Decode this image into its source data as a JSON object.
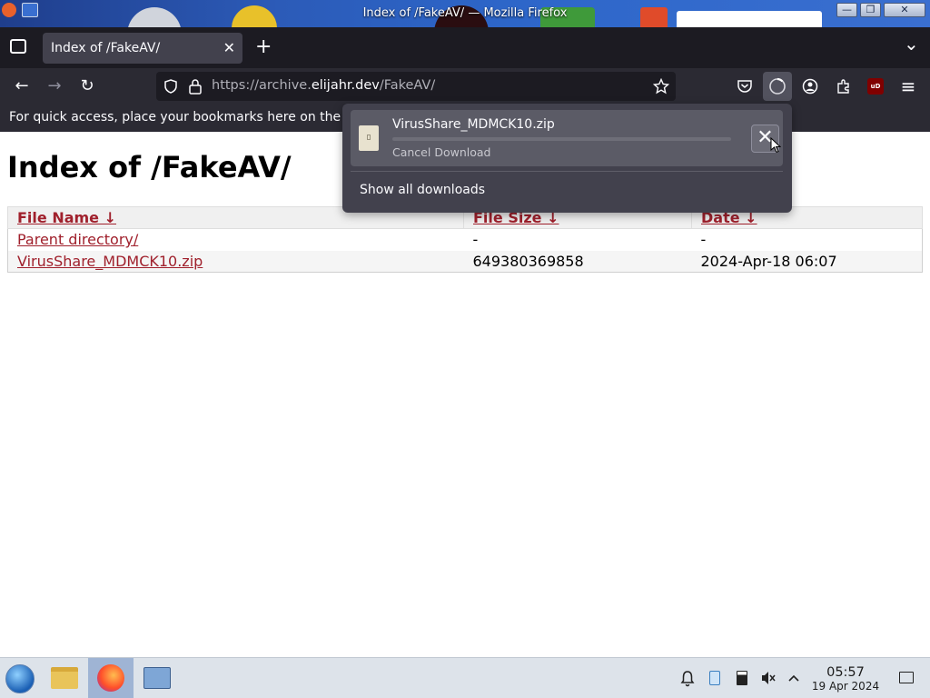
{
  "window": {
    "title": "Index of /FakeAV/ — Mozilla Firefox",
    "minimize_glyph": "—",
    "maximize_glyph": "❐",
    "close_glyph": "✕"
  },
  "tabs": [
    {
      "label": "Index of /FakeAV/",
      "active": true,
      "close_glyph": "✕"
    }
  ],
  "toolbar": {
    "new_tab_glyph": "+",
    "list_tabs_glyph": "⌄",
    "back_glyph": "←",
    "forward_glyph": "→",
    "reload_glyph": "↻",
    "menu_glyph": "≡",
    "url_prefix": "https://archive.",
    "url_domain": "elijahr.dev",
    "url_path": "/FakeAV/",
    "icons": [
      "tab-list-icon",
      "back-icon",
      "forward-icon",
      "reload-icon",
      "shield-icon",
      "lock-icon",
      "star-icon",
      "pocket-icon",
      "downloads-icon",
      "account-icon",
      "extensions-icon",
      "ublock-icon",
      "menu-icon"
    ],
    "ublock_label": "uD"
  },
  "bookmarks_bar": {
    "text": "For quick access, place your bookmarks here on the bo"
  },
  "page": {
    "heading": "Index of /FakeAV/",
    "columns": [
      "File Name  ↓",
      "File Size  ↓",
      "Date  ↓"
    ],
    "rows": [
      {
        "name": "Parent directory/",
        "size": "-",
        "date": "-"
      },
      {
        "name": "VirusShare_MDMCK10.zip",
        "size": "649380369858",
        "date": "2024-Apr-18 06:07"
      }
    ]
  },
  "downloads_panel": {
    "filename": "VirusShare_MDMCK10.zip",
    "status": "Cancel Download",
    "progress_fraction": 0.0,
    "cancel_glyph": "✕",
    "show_all_label": "Show all downloads"
  },
  "taskbar": {
    "items": [
      "start-button",
      "file-manager",
      "firefox",
      "control-panel"
    ],
    "clock_time": "05:57",
    "clock_date": "19 Apr 2024",
    "tray_icons": [
      "notifications-icon",
      "clipboard-icon",
      "battery-icon",
      "volume-muted-icon",
      "tray-expand-icon",
      "show-desktop-icon"
    ]
  }
}
